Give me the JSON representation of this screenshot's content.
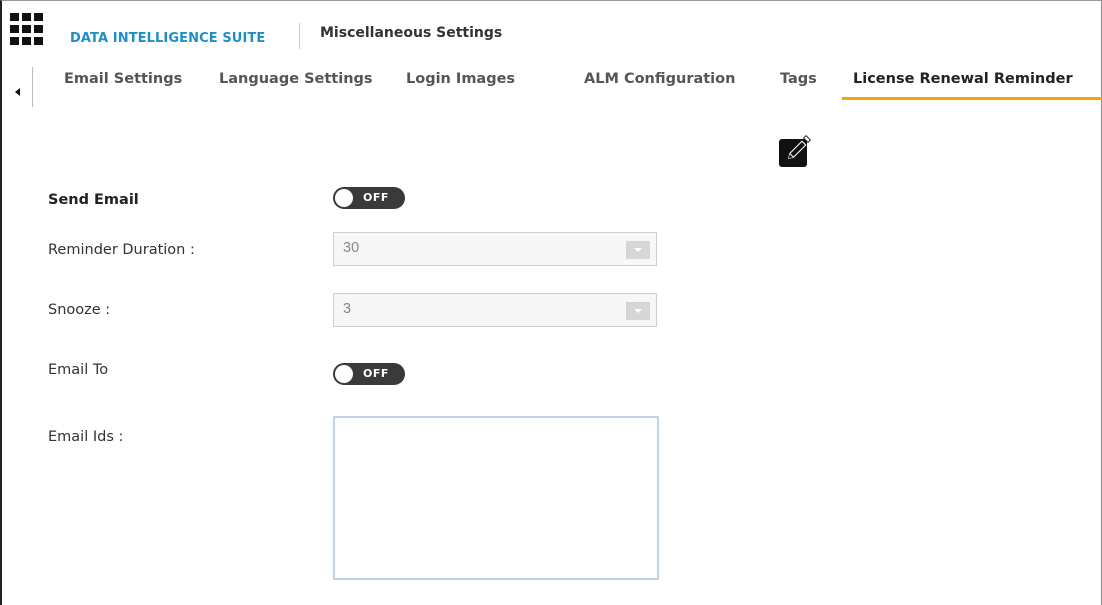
{
  "header": {
    "app_name": "DATA INTELLIGENCE SUITE",
    "page_title": "Miscellaneous Settings"
  },
  "tabs": [
    {
      "label": "Email Settings"
    },
    {
      "label": "Language Settings"
    },
    {
      "label": "Login Images"
    },
    {
      "label": "ALM Configuration"
    },
    {
      "label": "Tags"
    },
    {
      "label": "License Renewal Reminder",
      "active": true
    }
  ],
  "form": {
    "send_email": {
      "label": "Send Email",
      "state": "OFF"
    },
    "reminder_duration": {
      "label": "Reminder Duration :",
      "value": "30"
    },
    "snooze": {
      "label": "Snooze :",
      "value": "3"
    },
    "email_to": {
      "label": "Email To",
      "state": "OFF"
    },
    "email_ids": {
      "label": "Email Ids :",
      "value": ""
    }
  },
  "icons": {
    "app_launcher": "grid-icon",
    "tab_scroll": "chevron-left-icon",
    "edit": "pencil-edit-icon",
    "dropdown": "chevron-down-icon"
  },
  "colors": {
    "brand": "#1d8fc6",
    "active_tab_underline": "#f5a300",
    "toggle_off": "#3a3a3a"
  }
}
